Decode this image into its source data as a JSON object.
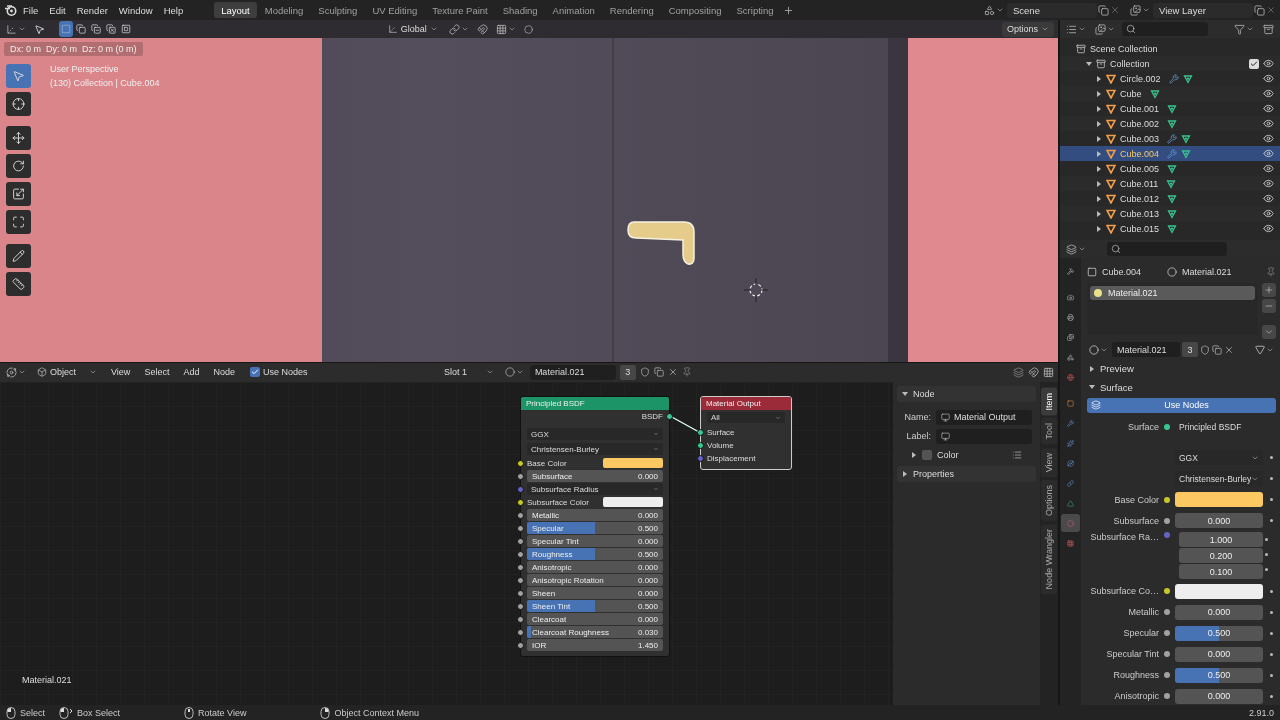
{
  "menu": [
    "File",
    "Edit",
    "Render",
    "Window",
    "Help"
  ],
  "workspaces": [
    {
      "label": "Layout",
      "selected": true
    },
    {
      "label": "Modeling",
      "selected": false
    },
    {
      "label": "Sculpting",
      "selected": false
    },
    {
      "label": "UV Editing",
      "selected": false
    },
    {
      "label": "Texture Paint",
      "selected": false
    },
    {
      "label": "Shading",
      "selected": false
    },
    {
      "label": "Animation",
      "selected": false
    },
    {
      "label": "Rendering",
      "selected": false
    },
    {
      "label": "Compositing",
      "selected": false
    },
    {
      "label": "Scripting",
      "selected": false
    }
  ],
  "scene": "Scene",
  "view_layer": "View Layer",
  "viewport": {
    "select_modes": [
      {
        "kind": "set",
        "selected": true
      },
      {
        "kind": "extend",
        "selected": false
      },
      {
        "kind": "subtract",
        "selected": false
      },
      {
        "kind": "difference",
        "selected": false
      },
      {
        "kind": "intersect",
        "selected": false
      }
    ],
    "orientation": "Global",
    "options": "Options",
    "delta": "Dx: 0 m  Dy: 0 m  Dz: 0 m (0 m)",
    "view_name": "User Perspective",
    "view_info": "(130) Collection | Cube.004",
    "tools": [
      {
        "kind": "select",
        "selected": true
      },
      {
        "kind": "cursor",
        "selected": false
      },
      {
        "kind": "move",
        "selected": false
      },
      {
        "kind": "rotate",
        "selected": false
      },
      {
        "kind": "scale",
        "selected": false
      },
      {
        "kind": "transform",
        "selected": false
      },
      {
        "kind": "annotate",
        "selected": false
      },
      {
        "kind": "measure",
        "selected": false
      }
    ]
  },
  "node_editor": {
    "mode": "Object",
    "menus": [
      "View",
      "Select",
      "Add",
      "Node"
    ],
    "use_nodes": {
      "label": "Use Nodes",
      "checked": true
    },
    "slot": "Slot 1",
    "material": "Material.021",
    "users": "3",
    "material_label": "Material.021",
    "nodes": [
      {
        "kind": "shader",
        "title": "Principled BSDF",
        "output": "BSDF",
        "dropdowns": [
          "GGX",
          "Christensen-Burley"
        ],
        "inputs": [
          {
            "kind": "color",
            "label": "Base Color",
            "color": "#fbc862"
          },
          {
            "kind": "value",
            "label": "Subsurface",
            "value": "0.000",
            "level": 0
          },
          {
            "kind": "vector",
            "label": "Subsurface Radius"
          },
          {
            "kind": "color",
            "label": "Subsurface Color",
            "color": "#eeeeee"
          },
          {
            "kind": "value",
            "label": "Metallic",
            "value": "0.000",
            "level": 0
          },
          {
            "kind": "value",
            "label": "Specular",
            "value": "0.500",
            "level": 0.5
          },
          {
            "kind": "value",
            "label": "Specular Tint",
            "value": "0.000",
            "level": 0
          },
          {
            "kind": "value",
            "label": "Roughness",
            "value": "0.500",
            "level": 0.5
          },
          {
            "kind": "value",
            "label": "Anisotropic",
            "value": "0.000",
            "level": 0
          },
          {
            "kind": "value",
            "label": "Anisotropic Rotation",
            "value": "0.000",
            "level": 0
          },
          {
            "kind": "value",
            "label": "Sheen",
            "value": "0.000",
            "level": 0
          },
          {
            "kind": "value",
            "label": "Sheen Tint",
            "value": "0.500",
            "level": 0.5
          },
          {
            "kind": "value",
            "label": "Clearcoat",
            "value": "0.000",
            "level": 0
          },
          {
            "kind": "value",
            "label": "Clearcoat Roughness",
            "value": "0.030",
            "level": 0.03
          },
          {
            "kind": "number",
            "label": "IOR",
            "value": "1.450"
          }
        ]
      },
      {
        "kind": "output",
        "title": "Material Output",
        "target": "All",
        "sockets": [
          {
            "label": "Surface",
            "kind": "shader"
          },
          {
            "label": "Volume",
            "kind": "shader"
          },
          {
            "label": "Displacement",
            "kind": "vector"
          }
        ]
      }
    ],
    "sidebar": {
      "panel": "Node",
      "expanded": true,
      "name_label": "Name:",
      "name": "Material Output",
      "label_label": "Label:",
      "color": {
        "label": "Color",
        "checked": false,
        "expanded": false
      },
      "properties": {
        "label": "Properties",
        "expanded": false
      }
    },
    "tabs": [
      {
        "label": "Item",
        "selected": true
      },
      {
        "label": "Tool",
        "selected": false
      },
      {
        "label": "View",
        "selected": false
      },
      {
        "label": "Options",
        "selected": false
      },
      {
        "label": "Node Wrangler",
        "selected": false
      }
    ]
  },
  "outliner": {
    "root": "Scene Collection",
    "collection": {
      "name": "Collection",
      "expanded": true,
      "checked": true,
      "children": [
        {
          "name": "Circle.002",
          "modifier": true,
          "selected": false
        },
        {
          "name": "Cube",
          "modifier": false,
          "selected": false
        },
        {
          "name": "Cube.001",
          "modifier": false,
          "selected": false
        },
        {
          "name": "Cube.002",
          "modifier": false,
          "selected": false
        },
        {
          "name": "Cube.003",
          "modifier": true,
          "selected": false
        },
        {
          "name": "Cube.004",
          "modifier": true,
          "selected": true
        },
        {
          "name": "Cube.005",
          "modifier": false,
          "selected": false
        },
        {
          "name": "Cube.011",
          "modifier": false,
          "selected": false
        },
        {
          "name": "Cube.012",
          "modifier": false,
          "selected": false
        },
        {
          "name": "Cube.013",
          "modifier": false,
          "selected": false
        },
        {
          "name": "Cube.015",
          "modifier": false,
          "selected": false
        }
      ]
    }
  },
  "properties": {
    "tabs": [
      {
        "kind": "tool",
        "selected": false
      },
      {
        "kind": "render",
        "selected": false
      },
      {
        "kind": "output",
        "selected": false
      },
      {
        "kind": "view_layer",
        "selected": false
      },
      {
        "kind": "scene",
        "selected": false
      },
      {
        "kind": "world",
        "selected": false
      },
      {
        "kind": "object",
        "selected": false
      },
      {
        "kind": "modifier",
        "selected": false
      },
      {
        "kind": "particles",
        "selected": false
      },
      {
        "kind": "physics",
        "selected": false
      },
      {
        "kind": "constraints",
        "selected": false
      },
      {
        "kind": "data",
        "selected": false
      },
      {
        "kind": "material",
        "selected": true
      },
      {
        "kind": "texture",
        "selected": false
      }
    ],
    "object": "Cube.004",
    "material": "Material.021",
    "slots": [
      {
        "name": "Material.021",
        "selected": true
      }
    ],
    "material_name": "Material.021",
    "users": "3",
    "panels": [
      {
        "label": "Preview",
        "expanded": false
      },
      {
        "label": "Surface",
        "expanded": true
      }
    ],
    "use_nodes": {
      "label": "Use Nodes",
      "on": true
    },
    "surface_label": "Surface",
    "surface_value": "Principled BSDF",
    "dropdowns": [
      "GGX",
      "Christensen-Burley"
    ],
    "inputs": [
      {
        "kind": "color",
        "label": "Base Color",
        "color": "#fbc862"
      },
      {
        "kind": "value",
        "label": "Subsurface",
        "value": "0.000",
        "level": 0
      },
      {
        "kind": "vector",
        "label": "Subsurface Ra…",
        "values": [
          "1.000",
          "0.200",
          "0.100"
        ]
      },
      {
        "kind": "color",
        "label": "Subsurface Co…",
        "color": "#eeeeee"
      },
      {
        "kind": "value",
        "label": "Metallic",
        "value": "0.000",
        "level": 0
      },
      {
        "kind": "value",
        "label": "Specular",
        "value": "0.500",
        "level": 0.5
      },
      {
        "kind": "value",
        "label": "Specular Tint",
        "value": "0.000",
        "level": 0
      },
      {
        "kind": "value",
        "label": "Roughness",
        "value": "0.500",
        "level": 0.5
      },
      {
        "kind": "value",
        "label": "Anisotropic",
        "value": "0.000",
        "level": 0
      }
    ]
  },
  "status": [
    {
      "kind": "left",
      "label": "Select"
    },
    {
      "kind": "drag",
      "label": "Box Select"
    },
    {
      "kind": "middle",
      "label": "Rotate View"
    },
    {
      "kind": "right",
      "label": "Object Context Menu"
    }
  ],
  "version": "2.91.0"
}
